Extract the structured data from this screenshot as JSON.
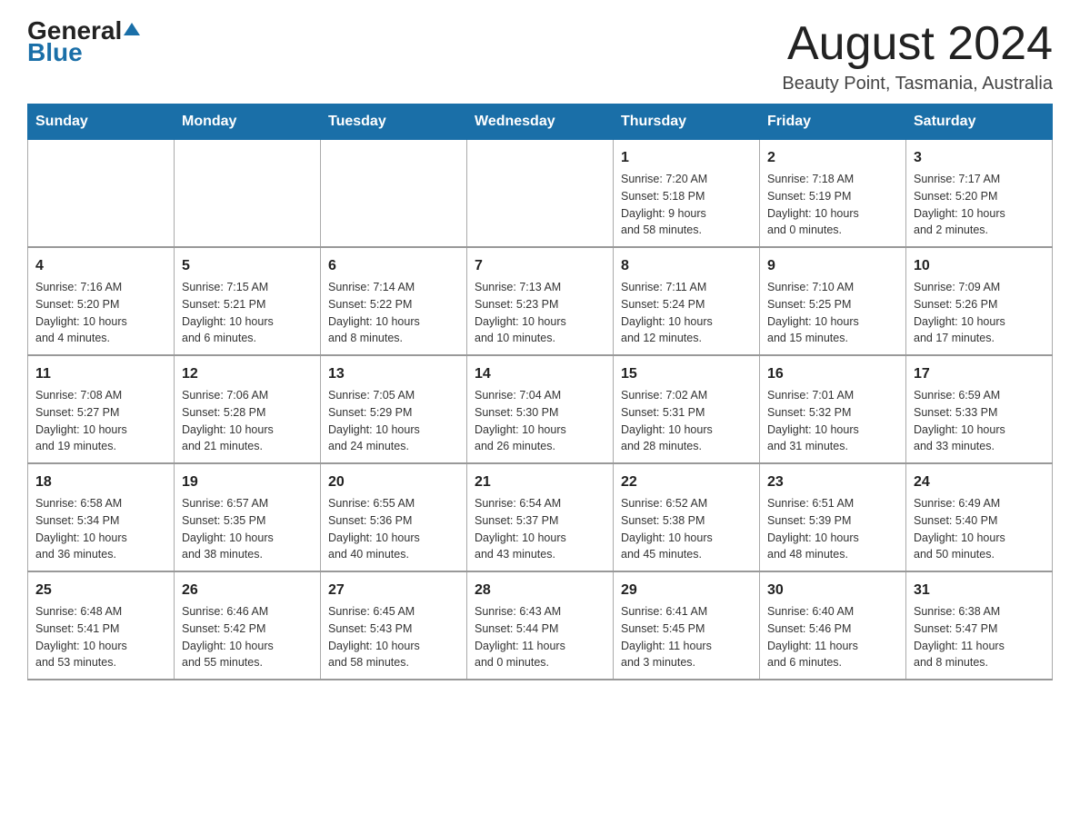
{
  "logo": {
    "text_general": "General",
    "text_blue": "Blue"
  },
  "header": {
    "month_title": "August 2024",
    "location": "Beauty Point, Tasmania, Australia"
  },
  "weekdays": [
    "Sunday",
    "Monday",
    "Tuesday",
    "Wednesday",
    "Thursday",
    "Friday",
    "Saturday"
  ],
  "weeks": [
    [
      {
        "day": "",
        "info": ""
      },
      {
        "day": "",
        "info": ""
      },
      {
        "day": "",
        "info": ""
      },
      {
        "day": "",
        "info": ""
      },
      {
        "day": "1",
        "info": "Sunrise: 7:20 AM\nSunset: 5:18 PM\nDaylight: 9 hours\nand 58 minutes."
      },
      {
        "day": "2",
        "info": "Sunrise: 7:18 AM\nSunset: 5:19 PM\nDaylight: 10 hours\nand 0 minutes."
      },
      {
        "day": "3",
        "info": "Sunrise: 7:17 AM\nSunset: 5:20 PM\nDaylight: 10 hours\nand 2 minutes."
      }
    ],
    [
      {
        "day": "4",
        "info": "Sunrise: 7:16 AM\nSunset: 5:20 PM\nDaylight: 10 hours\nand 4 minutes."
      },
      {
        "day": "5",
        "info": "Sunrise: 7:15 AM\nSunset: 5:21 PM\nDaylight: 10 hours\nand 6 minutes."
      },
      {
        "day": "6",
        "info": "Sunrise: 7:14 AM\nSunset: 5:22 PM\nDaylight: 10 hours\nand 8 minutes."
      },
      {
        "day": "7",
        "info": "Sunrise: 7:13 AM\nSunset: 5:23 PM\nDaylight: 10 hours\nand 10 minutes."
      },
      {
        "day": "8",
        "info": "Sunrise: 7:11 AM\nSunset: 5:24 PM\nDaylight: 10 hours\nand 12 minutes."
      },
      {
        "day": "9",
        "info": "Sunrise: 7:10 AM\nSunset: 5:25 PM\nDaylight: 10 hours\nand 15 minutes."
      },
      {
        "day": "10",
        "info": "Sunrise: 7:09 AM\nSunset: 5:26 PM\nDaylight: 10 hours\nand 17 minutes."
      }
    ],
    [
      {
        "day": "11",
        "info": "Sunrise: 7:08 AM\nSunset: 5:27 PM\nDaylight: 10 hours\nand 19 minutes."
      },
      {
        "day": "12",
        "info": "Sunrise: 7:06 AM\nSunset: 5:28 PM\nDaylight: 10 hours\nand 21 minutes."
      },
      {
        "day": "13",
        "info": "Sunrise: 7:05 AM\nSunset: 5:29 PM\nDaylight: 10 hours\nand 24 minutes."
      },
      {
        "day": "14",
        "info": "Sunrise: 7:04 AM\nSunset: 5:30 PM\nDaylight: 10 hours\nand 26 minutes."
      },
      {
        "day": "15",
        "info": "Sunrise: 7:02 AM\nSunset: 5:31 PM\nDaylight: 10 hours\nand 28 minutes."
      },
      {
        "day": "16",
        "info": "Sunrise: 7:01 AM\nSunset: 5:32 PM\nDaylight: 10 hours\nand 31 minutes."
      },
      {
        "day": "17",
        "info": "Sunrise: 6:59 AM\nSunset: 5:33 PM\nDaylight: 10 hours\nand 33 minutes."
      }
    ],
    [
      {
        "day": "18",
        "info": "Sunrise: 6:58 AM\nSunset: 5:34 PM\nDaylight: 10 hours\nand 36 minutes."
      },
      {
        "day": "19",
        "info": "Sunrise: 6:57 AM\nSunset: 5:35 PM\nDaylight: 10 hours\nand 38 minutes."
      },
      {
        "day": "20",
        "info": "Sunrise: 6:55 AM\nSunset: 5:36 PM\nDaylight: 10 hours\nand 40 minutes."
      },
      {
        "day": "21",
        "info": "Sunrise: 6:54 AM\nSunset: 5:37 PM\nDaylight: 10 hours\nand 43 minutes."
      },
      {
        "day": "22",
        "info": "Sunrise: 6:52 AM\nSunset: 5:38 PM\nDaylight: 10 hours\nand 45 minutes."
      },
      {
        "day": "23",
        "info": "Sunrise: 6:51 AM\nSunset: 5:39 PM\nDaylight: 10 hours\nand 48 minutes."
      },
      {
        "day": "24",
        "info": "Sunrise: 6:49 AM\nSunset: 5:40 PM\nDaylight: 10 hours\nand 50 minutes."
      }
    ],
    [
      {
        "day": "25",
        "info": "Sunrise: 6:48 AM\nSunset: 5:41 PM\nDaylight: 10 hours\nand 53 minutes."
      },
      {
        "day": "26",
        "info": "Sunrise: 6:46 AM\nSunset: 5:42 PM\nDaylight: 10 hours\nand 55 minutes."
      },
      {
        "day": "27",
        "info": "Sunrise: 6:45 AM\nSunset: 5:43 PM\nDaylight: 10 hours\nand 58 minutes."
      },
      {
        "day": "28",
        "info": "Sunrise: 6:43 AM\nSunset: 5:44 PM\nDaylight: 11 hours\nand 0 minutes."
      },
      {
        "day": "29",
        "info": "Sunrise: 6:41 AM\nSunset: 5:45 PM\nDaylight: 11 hours\nand 3 minutes."
      },
      {
        "day": "30",
        "info": "Sunrise: 6:40 AM\nSunset: 5:46 PM\nDaylight: 11 hours\nand 6 minutes."
      },
      {
        "day": "31",
        "info": "Sunrise: 6:38 AM\nSunset: 5:47 PM\nDaylight: 11 hours\nand 8 minutes."
      }
    ]
  ]
}
